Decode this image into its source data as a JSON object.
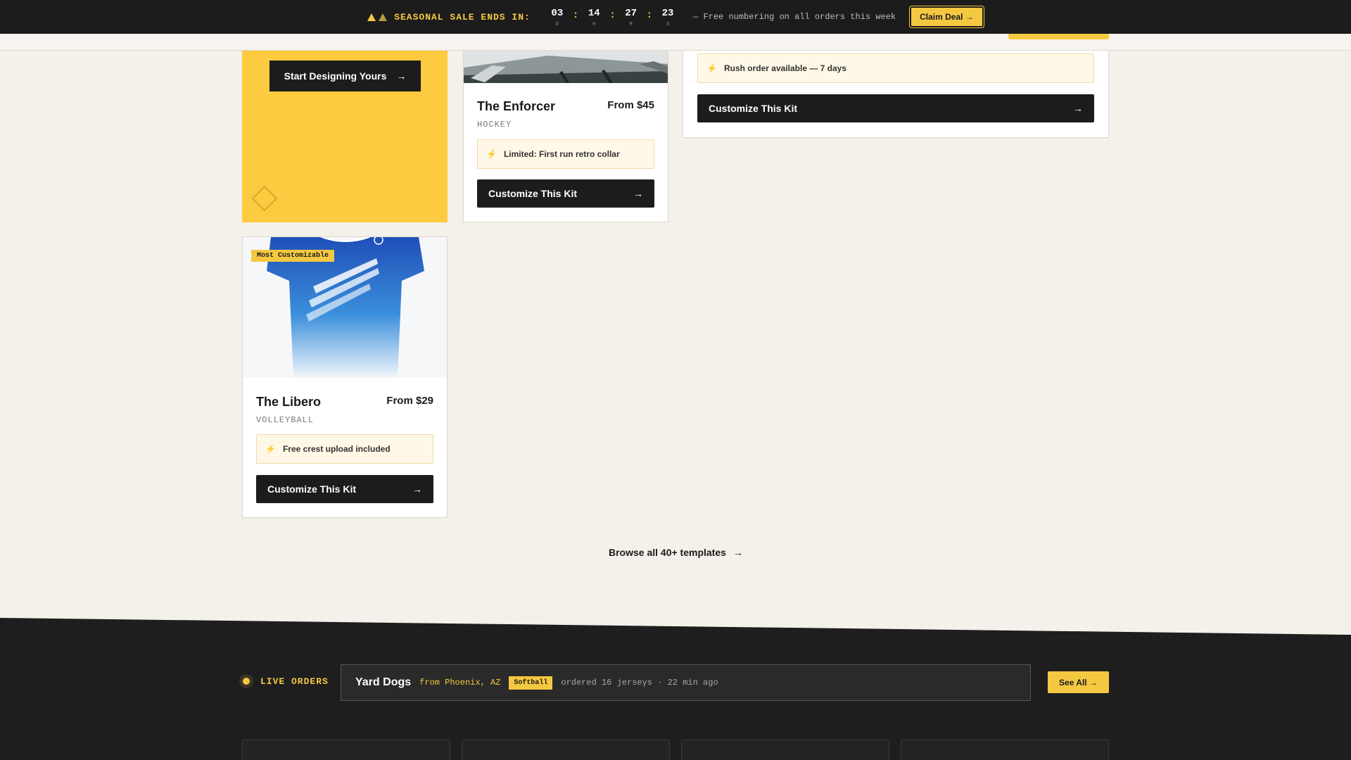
{
  "promo": {
    "sale_label": "SEASONAL SALE ENDS IN:",
    "countdown": [
      {
        "value": "03",
        "unit": "D"
      },
      {
        "value": "14",
        "unit": "H"
      },
      {
        "value": "27",
        "unit": "M"
      },
      {
        "value": "23",
        "unit": "S"
      }
    ],
    "separator": ":",
    "free_text": "— Free numbering on all orders this week",
    "claim_label": "Claim Deal →"
  },
  "hero": {
    "button_label": "Start Designing Yours",
    "button_arrow": "→"
  },
  "products": [
    {
      "title": "The Enforcer",
      "price": "From $45",
      "sport": "HOCKEY",
      "note": "Limited: First run retro collar",
      "button": "Customize This Kit",
      "arrow": "→"
    },
    {
      "note": "Rush order available — 7 days",
      "button": "Customize This Kit",
      "arrow": "→"
    },
    {
      "badge": "Most Customizable",
      "title": "The Libero",
      "price": "From $29",
      "sport": "VOLLEYBALL",
      "note": "Free crest upload included",
      "button": "Customize This Kit",
      "arrow": "→"
    }
  ],
  "bolt_glyph": "⚡",
  "browse": {
    "label": "Browse all 40+ templates",
    "arrow": "→"
  },
  "live_orders": {
    "label": "LIVE ORDERS",
    "team": "Yard Dogs",
    "from": "from Phoenix, AZ",
    "sport_tag": "Softball",
    "detail": "ordered 16 jerseys · 22 min ago",
    "see_all": "See All →"
  },
  "colors": {
    "accent": "#f5c842",
    "dark": "#1c1c1c",
    "background": "#f4f0ea"
  }
}
